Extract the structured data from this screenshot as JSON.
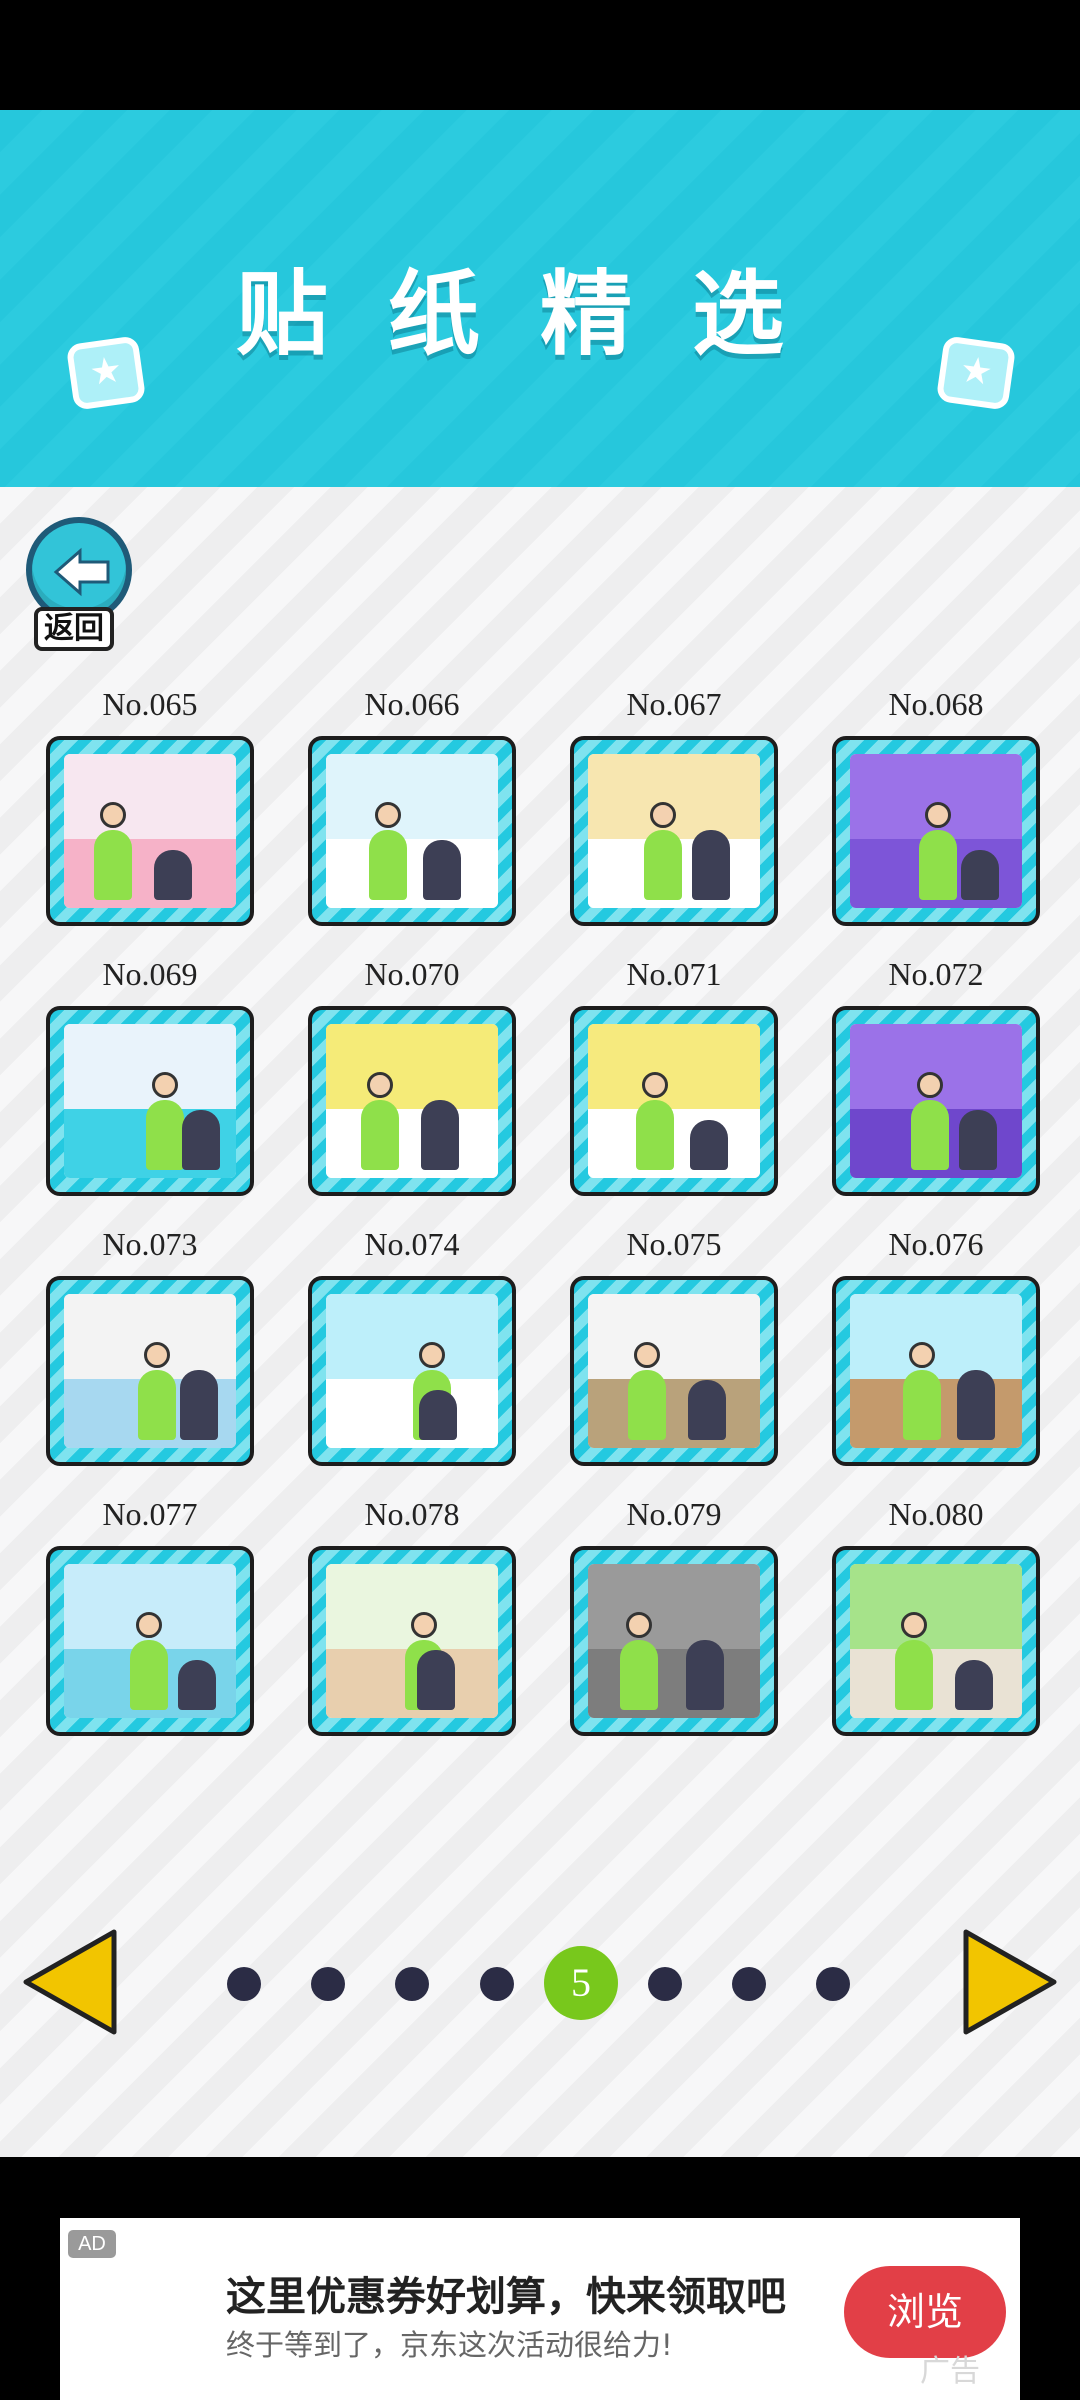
{
  "header": {
    "title": "贴纸精选"
  },
  "back_button": {
    "label": "返回"
  },
  "stickers": [
    {
      "no": "No.065"
    },
    {
      "no": "No.066"
    },
    {
      "no": "No.067"
    },
    {
      "no": "No.068"
    },
    {
      "no": "No.069"
    },
    {
      "no": "No.070"
    },
    {
      "no": "No.071"
    },
    {
      "no": "No.072"
    },
    {
      "no": "No.073"
    },
    {
      "no": "No.074"
    },
    {
      "no": "No.075"
    },
    {
      "no": "No.076"
    },
    {
      "no": "No.077"
    },
    {
      "no": "No.078"
    },
    {
      "no": "No.079"
    },
    {
      "no": "No.080"
    }
  ],
  "pagination": {
    "current_label": "5",
    "total_pages": 8,
    "current_page": 5
  },
  "ad": {
    "tag": "AD",
    "headline": "这里优惠券好划算，快来领取吧",
    "subline": "终于等到了，京东这次活动很给力!",
    "button_label": "浏览",
    "watermark": "广告"
  },
  "colors": {
    "header_bg": "#26c7dc",
    "frame_stripe": "#24c9e0",
    "active_dot": "#78c81c",
    "inactive_dot": "#2b2c45",
    "arrow": "#f2c500",
    "ad_button": "#e23f47"
  }
}
